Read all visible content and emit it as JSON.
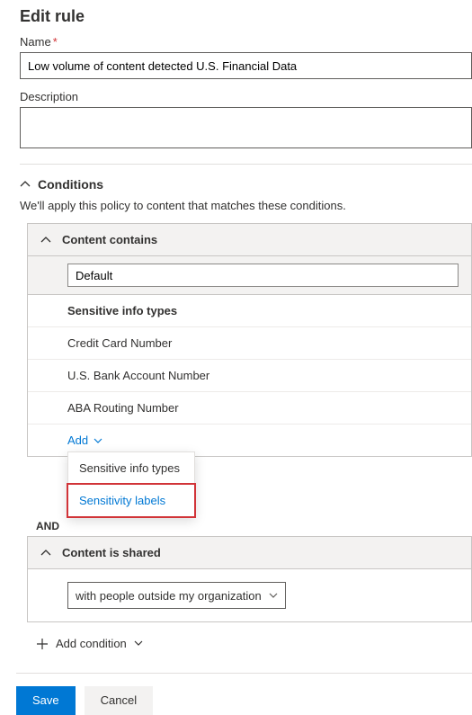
{
  "page": {
    "title": "Edit rule"
  },
  "fields": {
    "name_label": "Name",
    "name_value": "Low volume of content detected U.S. Financial Data",
    "description_label": "Description",
    "description_value": ""
  },
  "conditions": {
    "section_title": "Conditions",
    "section_desc": "We'll apply this policy to content that matches these conditions.",
    "content_contains_label": "Content contains",
    "default_value": "Default",
    "sensitive_header": "Sensitive info types",
    "items": [
      "Credit Card Number",
      "U.S. Bank Account Number",
      "ABA Routing Number"
    ],
    "add_label": "Add",
    "dropdown": {
      "item1": "Sensitive info types",
      "item2": "Sensitivity labels"
    },
    "and_label": "AND",
    "shared_label": "Content is shared",
    "shared_value": "with people outside my organization",
    "add_condition_label": "Add condition"
  },
  "footer": {
    "save": "Save",
    "cancel": "Cancel"
  }
}
